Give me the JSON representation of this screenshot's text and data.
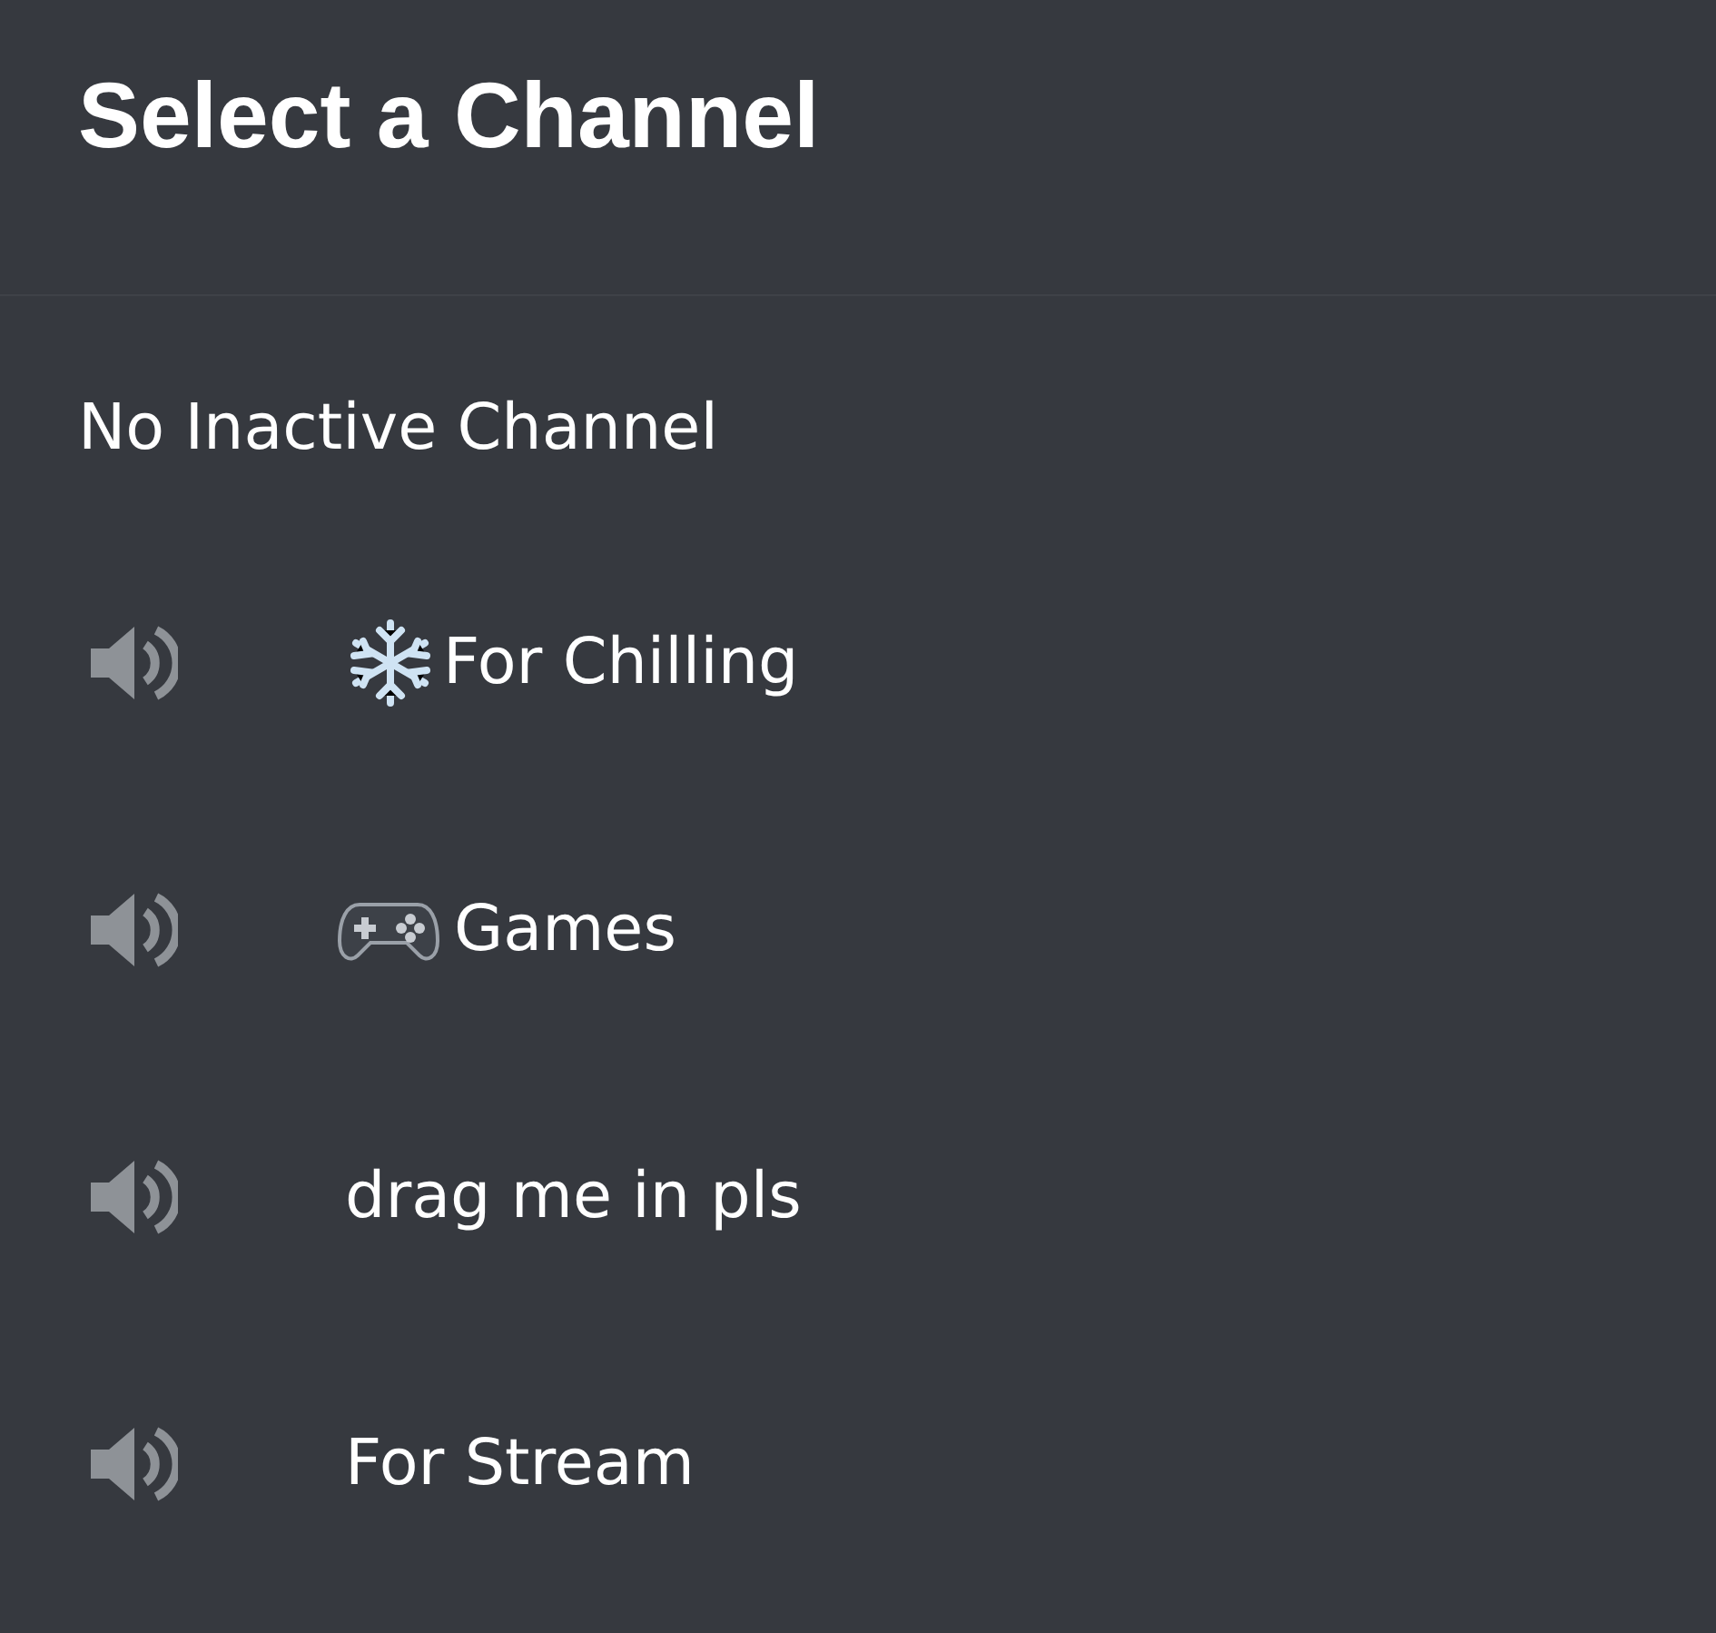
{
  "header": {
    "title": "Select a Channel"
  },
  "inactive_option": {
    "label": "No Inactive Channel"
  },
  "channels": [
    {
      "kind": "snowflake",
      "name": "For Chilling"
    },
    {
      "kind": "gamepad",
      "name": "Games"
    },
    {
      "kind": "plain",
      "name": "drag me in pls"
    },
    {
      "kind": "plain",
      "name": "For Stream"
    }
  ]
}
